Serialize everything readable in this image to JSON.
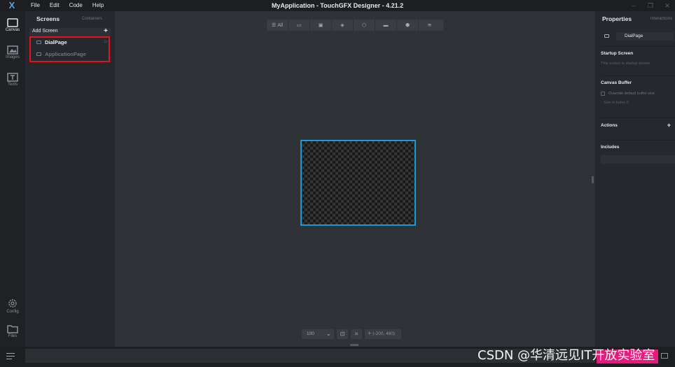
{
  "app": {
    "title": "MyApplication - TouchGFX Designer - 4.21.2",
    "logo": "X"
  },
  "menu": [
    "File",
    "Edit",
    "Code",
    "Help"
  ],
  "rail": {
    "canvas": "Canvas",
    "images": "Images",
    "texts": "Texts",
    "config": "Config",
    "files": "Files"
  },
  "screens_panel": {
    "title": "Screens",
    "alt_tab": "Containers",
    "add_screen": "Add Screen",
    "add_icon": "+",
    "items": [
      {
        "name": "DialPage",
        "selected": true
      },
      {
        "name": "ApplicationPage",
        "selected": false
      }
    ]
  },
  "toolbar": {
    "all": "All",
    "icons": [
      "screen-icon",
      "image-icon",
      "layers-icon",
      "shapes-icon",
      "container-icon",
      "cube-icon",
      "stack-icon"
    ]
  },
  "canvas": {
    "zoom": "100",
    "coords": "(-200, 460)"
  },
  "properties": {
    "title": "Properties",
    "alt_tab": "Interactions",
    "screen_name": "DialPage",
    "startup_title": "Startup Screen",
    "startup_sub": "This screen is startup screen",
    "buffer_title": "Canvas Buffer",
    "buffer_check": "Override default buffer size",
    "buffer_size": "Size in bytes   0",
    "actions_title": "Actions",
    "actions_add": "+",
    "includes_title": "Includes"
  },
  "watermark": "CSDN @华清远见IT开放实验室",
  "colors": {
    "accent_blue": "#1a9ad6",
    "highlight_red": "#e0141e",
    "run_pink": "#e6197d"
  }
}
